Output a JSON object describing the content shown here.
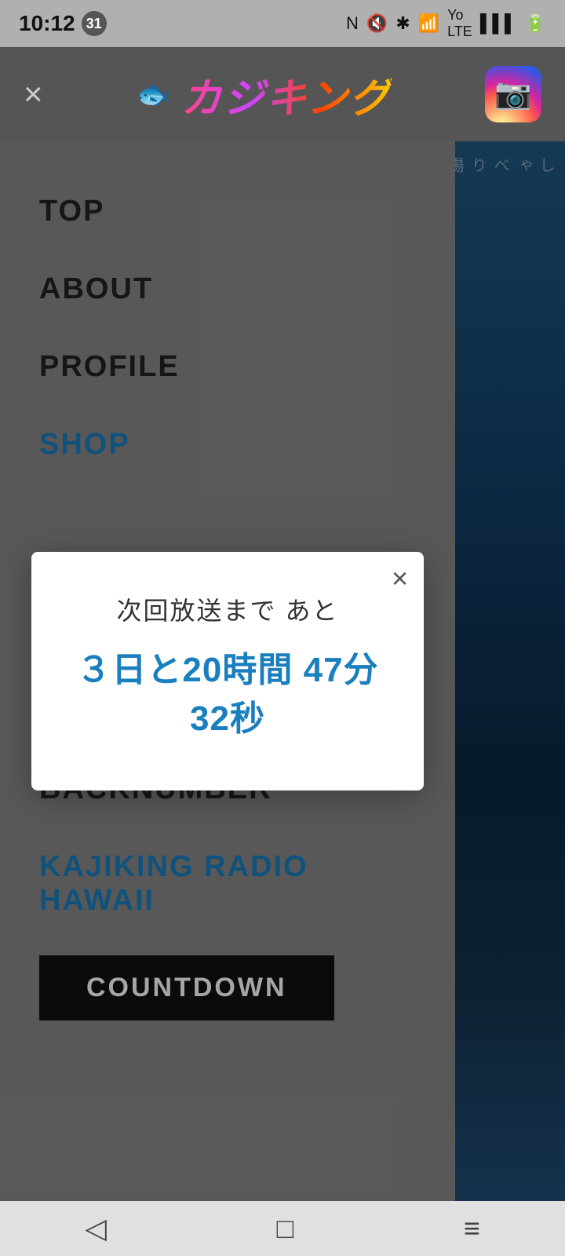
{
  "statusBar": {
    "time": "10:12",
    "badge": "31",
    "icons": [
      "N",
      "🔇",
      "🔊",
      "🔵",
      "📶",
      "Yo",
      "📶",
      "🔋"
    ]
  },
  "header": {
    "closeLabel": "×",
    "logoText": "カジキング",
    "instagramIcon": "📷"
  },
  "menu": {
    "items": [
      {
        "label": "TOP",
        "active": false
      },
      {
        "label": "ABOUT",
        "active": false
      },
      {
        "label": "PROFILE",
        "active": false
      },
      {
        "label": "SHOP",
        "active": true
      },
      {
        "label": "BACKNUMBER",
        "active": false
      },
      {
        "label": "KAJIKING RADIO HAWAII",
        "active": true
      }
    ],
    "countdownButton": "COUNTDOWN"
  },
  "modal": {
    "closeLabel": "×",
    "subtitle": "次回放送まで あと",
    "countdown": "３日と20時間 47分\n32秒"
  },
  "bottomNav": {
    "back": "◁",
    "home": "□",
    "menu": "≡"
  }
}
